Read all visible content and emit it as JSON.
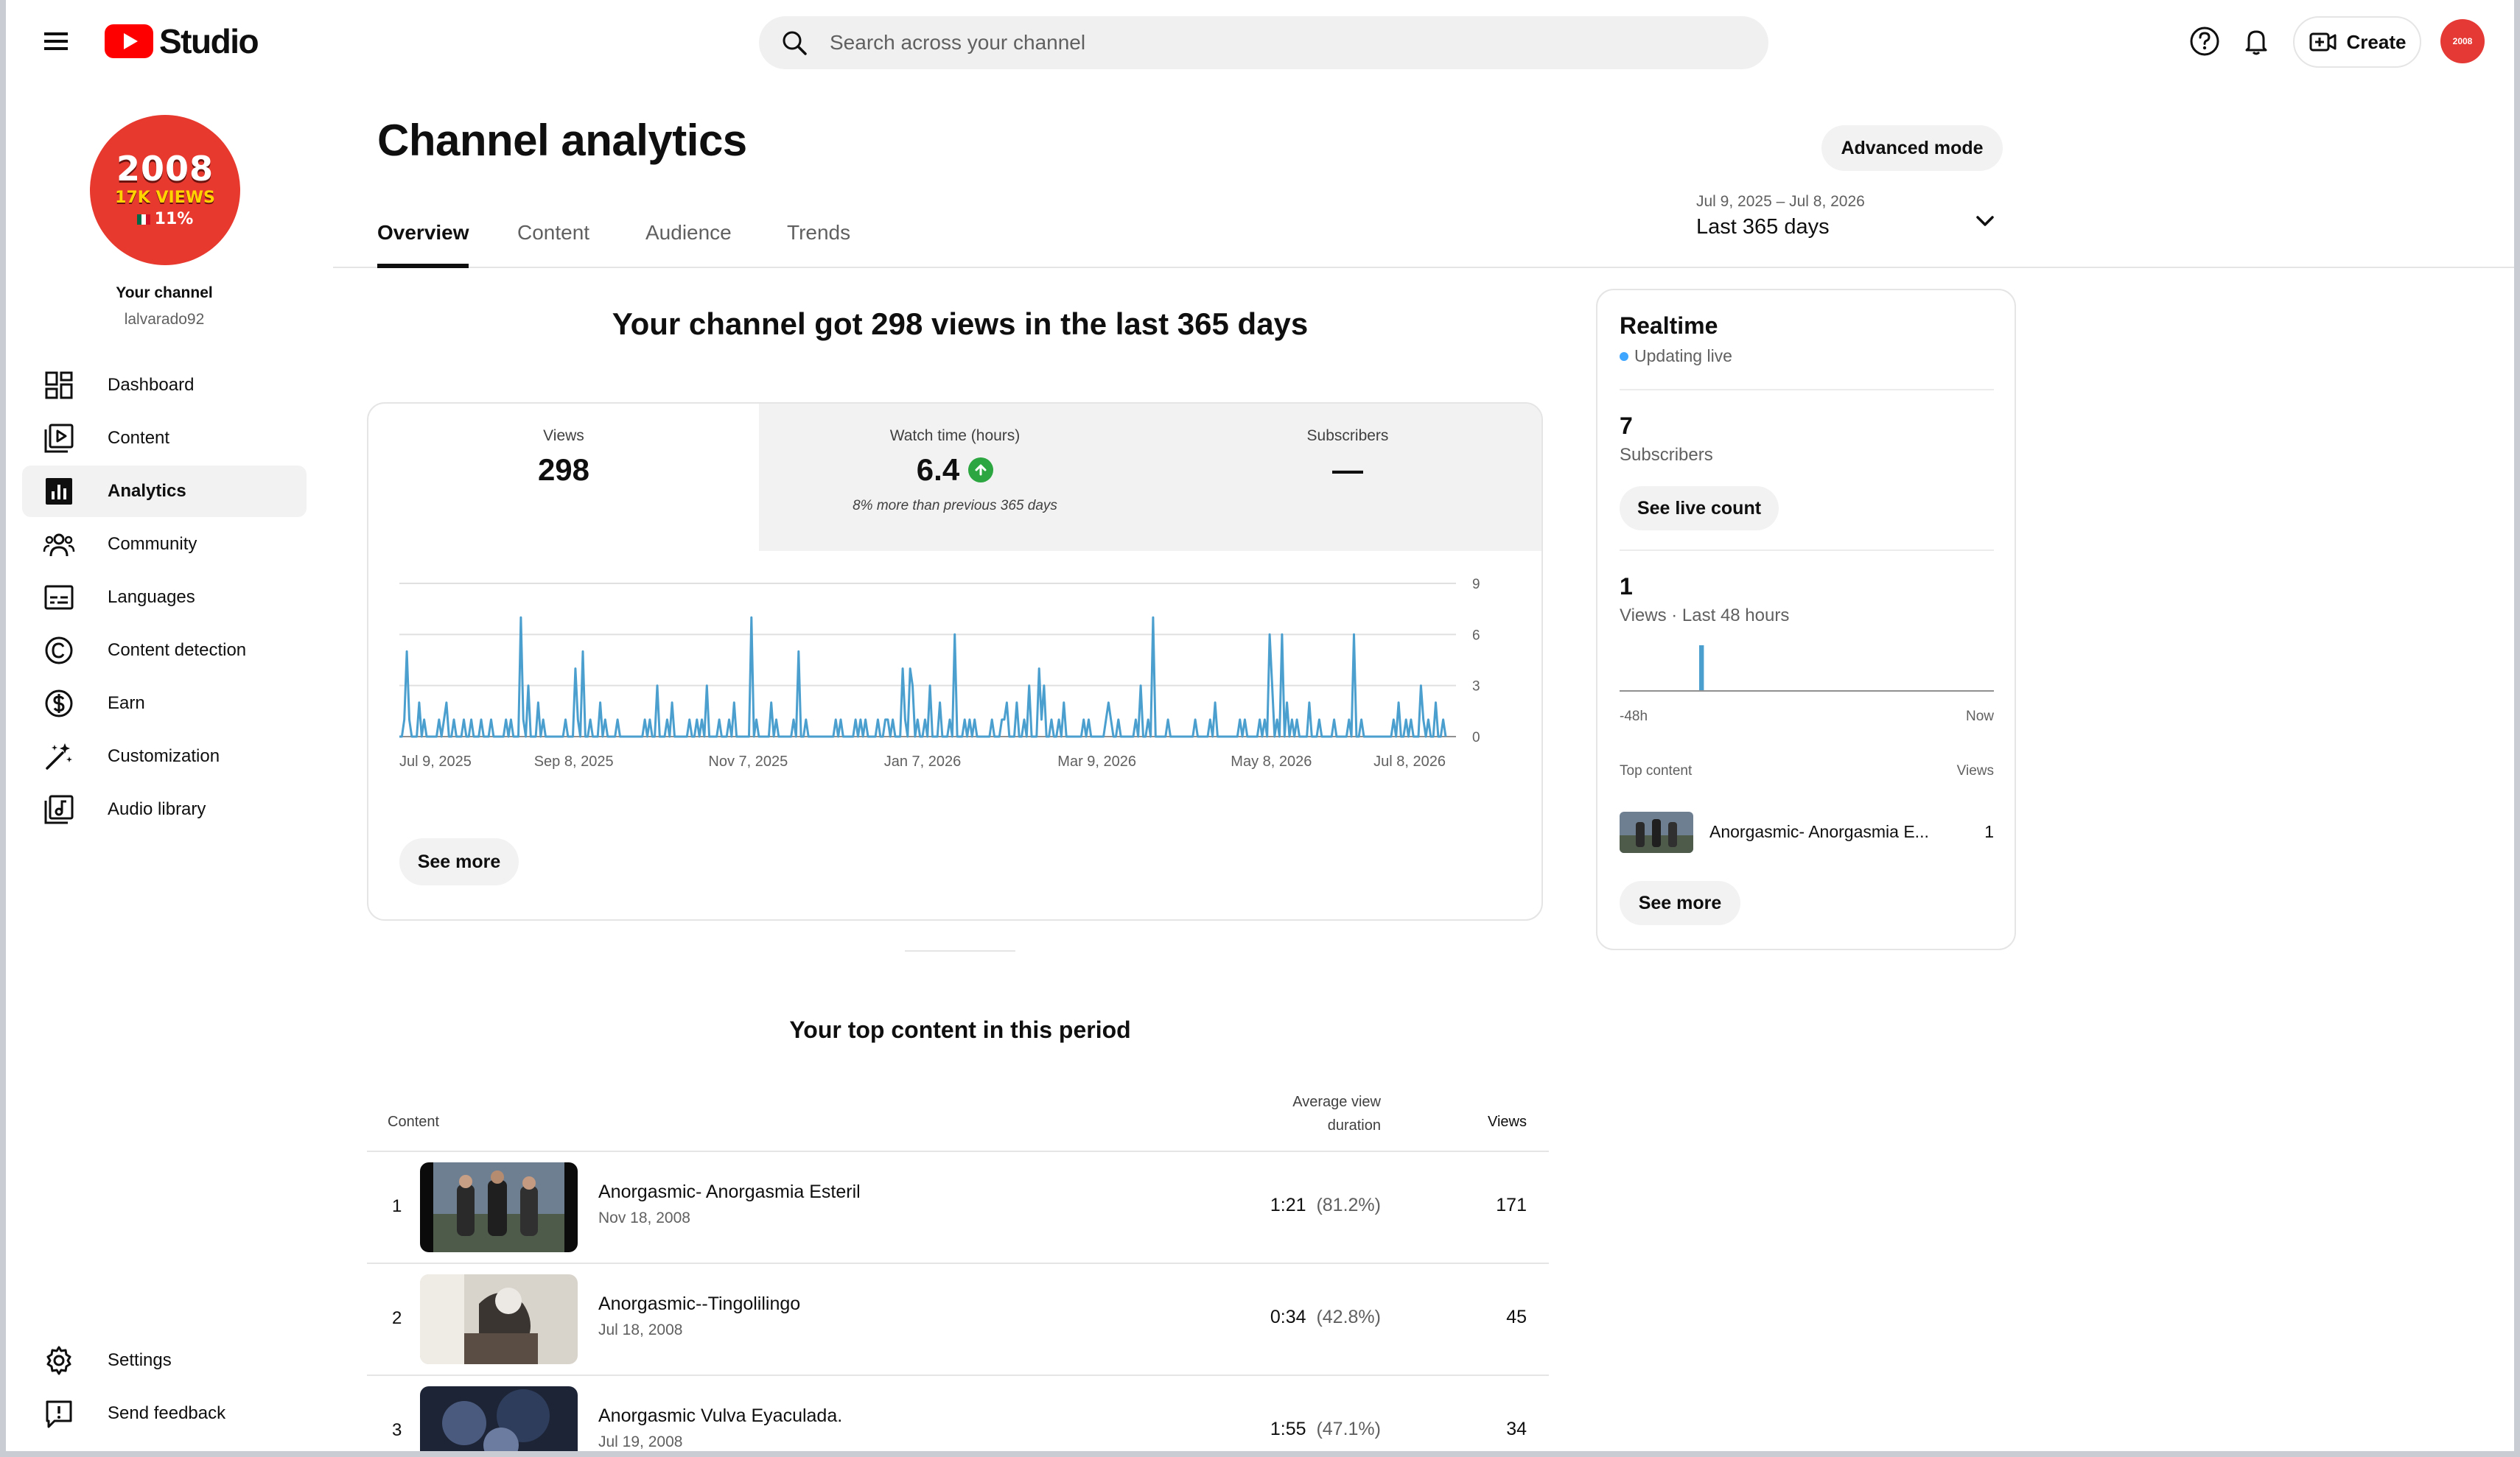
{
  "topbar": {
    "logo_text": "Studio",
    "search_placeholder": "Search across your channel",
    "create_label": "Create",
    "avatar_text": "2008"
  },
  "sidebar": {
    "avatar": {
      "year": "2008",
      "views": "17K VIEWS",
      "pct": "11%"
    },
    "channel_label": "Your channel",
    "channel_handle": "lalvarado92",
    "items": [
      {
        "label": "Dashboard",
        "icon": "dashboard-icon"
      },
      {
        "label": "Content",
        "icon": "content-icon"
      },
      {
        "label": "Analytics",
        "icon": "analytics-icon",
        "active": true
      },
      {
        "label": "Community",
        "icon": "community-icon"
      },
      {
        "label": "Languages",
        "icon": "subtitles-icon"
      },
      {
        "label": "Content detection",
        "icon": "copyright-icon"
      },
      {
        "label": "Earn",
        "icon": "dollar-icon"
      },
      {
        "label": "Customization",
        "icon": "magic-wand-icon"
      },
      {
        "label": "Audio library",
        "icon": "audio-library-icon"
      }
    ],
    "bottom_items": [
      {
        "label": "Settings",
        "icon": "gear-icon"
      },
      {
        "label": "Send feedback",
        "icon": "feedback-icon"
      }
    ]
  },
  "header": {
    "title": "Channel analytics",
    "advanced_mode": "Advanced mode",
    "tabs": [
      "Overview",
      "Content",
      "Audience",
      "Trends"
    ],
    "date_range": "Jul 9, 2025 – Jul 8, 2026",
    "date_label": "Last 365 days"
  },
  "overview": {
    "headline": "Your channel got 298 views in the last 365 days",
    "metrics": [
      {
        "label": "Views",
        "value": "298",
        "note": ""
      },
      {
        "label": "Watch time (hours)",
        "value": "6.4",
        "note": "8% more than previous 365 days",
        "trend": "up"
      },
      {
        "label": "Subscribers",
        "value": "—",
        "note": ""
      }
    ],
    "see_more": "See more"
  },
  "chart_data": {
    "type": "line",
    "series_color": "#4a9fcf",
    "x_tick_labels": [
      "Jul 9, 2025",
      "Sep 8, 2025",
      "Nov 7, 2025",
      "Jan 7, 2026",
      "Mar 9, 2026",
      "May 8, 2026",
      "Jul 8, 2026"
    ],
    "y_ticks": [
      0,
      3,
      6,
      9
    ],
    "ylim": [
      0,
      9
    ],
    "grid": true,
    "values": [
      0,
      0,
      1,
      5,
      1,
      0,
      0,
      0,
      2,
      0,
      1,
      0,
      0,
      0,
      0,
      0,
      1,
      0,
      1,
      2,
      0,
      0,
      1,
      0,
      0,
      0,
      1,
      0,
      0,
      1,
      0,
      0,
      0,
      1,
      0,
      0,
      0,
      1,
      0,
      0,
      0,
      0,
      0,
      1,
      0,
      1,
      0,
      0,
      0,
      7,
      1,
      0,
      3,
      0,
      0,
      0,
      2,
      0,
      1,
      0,
      0,
      0,
      0,
      0,
      0,
      0,
      0,
      1,
      0,
      0,
      0,
      4,
      1,
      0,
      5,
      0,
      0,
      1,
      0,
      0,
      0,
      2,
      0,
      1,
      0,
      0,
      0,
      0,
      1,
      0,
      0,
      0,
      0,
      0,
      0,
      0,
      0,
      0,
      0,
      1,
      0,
      1,
      0,
      0,
      3,
      0,
      0,
      0,
      1,
      0,
      2,
      0,
      0,
      0,
      0,
      0,
      0,
      1,
      0,
      0,
      1,
      0,
      1,
      0,
      3,
      0,
      0,
      0,
      0,
      1,
      0,
      0,
      0,
      1,
      0,
      2,
      0,
      0,
      0,
      0,
      0,
      0,
      7,
      0,
      1,
      0,
      0,
      0,
      0,
      0,
      2,
      0,
      1,
      0,
      0,
      0,
      0,
      0,
      0,
      1,
      0,
      5,
      0,
      0,
      1,
      0,
      0,
      0,
      0,
      0,
      0,
      0,
      0,
      0,
      0,
      0,
      1,
      0,
      1,
      0,
      0,
      0,
      0,
      0,
      1,
      0,
      1,
      0,
      1,
      0,
      0,
      0,
      0,
      1,
      0,
      0,
      1,
      1,
      0,
      1,
      0,
      0,
      0,
      4,
      1,
      0,
      4,
      3,
      0,
      1,
      0,
      0,
      1,
      0,
      3,
      0,
      0,
      0,
      2,
      0,
      0,
      0,
      1,
      0,
      6,
      0,
      0,
      0,
      1,
      0,
      1,
      0,
      1,
      0,
      0,
      0,
      0,
      0,
      0,
      1,
      0,
      0,
      0,
      1,
      1,
      2,
      0,
      0,
      0,
      2,
      0,
      0,
      1,
      0,
      3,
      0,
      0,
      0,
      4,
      1,
      3,
      0,
      0,
      1,
      0,
      0,
      1,
      0,
      2,
      0,
      0,
      0,
      0,
      0,
      0,
      0,
      1,
      0,
      1,
      0,
      0,
      0,
      0,
      0,
      0,
      1,
      2,
      1,
      0,
      0,
      1,
      0,
      0,
      0,
      0,
      0,
      0,
      1,
      0,
      3,
      0,
      0,
      1,
      0,
      7,
      0,
      0,
      0,
      0,
      0,
      1,
      0,
      0,
      0,
      0,
      0,
      0,
      0,
      0,
      0,
      0,
      1,
      0,
      0,
      0,
      0,
      0,
      1,
      0,
      2,
      0,
      0,
      0,
      0,
      0,
      0,
      0,
      0,
      0,
      1,
      0,
      1,
      0,
      0,
      0,
      0,
      0,
      1,
      0,
      1,
      0,
      6,
      3,
      0,
      1,
      0,
      6,
      0,
      2,
      0,
      1,
      0,
      1,
      0,
      0,
      0,
      0,
      2,
      0,
      0,
      0,
      1,
      0,
      0,
      0,
      0,
      0,
      1,
      0,
      0,
      0,
      0,
      0,
      1,
      0,
      6,
      0,
      0,
      1,
      0,
      0,
      0,
      0,
      0,
      0,
      0,
      0,
      0,
      0,
      0,
      0,
      1,
      0,
      2,
      0,
      0,
      1,
      0,
      1,
      0,
      0,
      0,
      3,
      1,
      0,
      1,
      0,
      0,
      2,
      0,
      0,
      1,
      0
    ]
  },
  "top_content": {
    "title": "Your top content in this period",
    "col_content": "Content",
    "col_duration_line1": "Average view",
    "col_duration_line2": "duration",
    "col_views": "Views",
    "rows": [
      {
        "rank": "1",
        "title": "Anorgasmic- Anorgasmia Esteril",
        "date": "Nov 18, 2008",
        "duration": "1:21",
        "pct": "(81.2%)",
        "views": "171"
      },
      {
        "rank": "2",
        "title": "Anorgasmic--Tingolilingo",
        "date": "Jul 18, 2008",
        "duration": "0:34",
        "pct": "(42.8%)",
        "views": "45"
      },
      {
        "rank": "3",
        "title": "Anorgasmic Vulva Eyaculada.",
        "date": "Jul 19, 2008",
        "duration": "1:55",
        "pct": "(47.1%)",
        "views": "34"
      }
    ]
  },
  "realtime": {
    "title": "Realtime",
    "live_text": "Updating live",
    "subscribers_value": "7",
    "subscribers_label": "Subscribers",
    "see_live_count": "See live count",
    "views_value": "1",
    "views_label": "Views · Last 48 hours",
    "axis_start": "-48h",
    "axis_end": "Now",
    "bars": [
      0,
      0,
      0,
      0,
      0,
      0,
      0,
      0,
      0,
      0,
      1,
      0,
      0,
      0,
      0,
      0,
      0,
      0,
      0,
      0,
      0,
      0,
      0,
      0,
      0,
      0,
      0,
      0,
      0,
      0,
      0,
      0,
      0,
      0,
      0,
      0,
      0,
      0,
      0,
      0,
      0,
      0,
      0,
      0,
      0,
      0,
      0,
      0
    ],
    "top_content_label": "Top content",
    "views_col": "Views",
    "top_title": "Anorgasmic- Anorgasmia E...",
    "top_views": "1",
    "see_more": "See more"
  }
}
